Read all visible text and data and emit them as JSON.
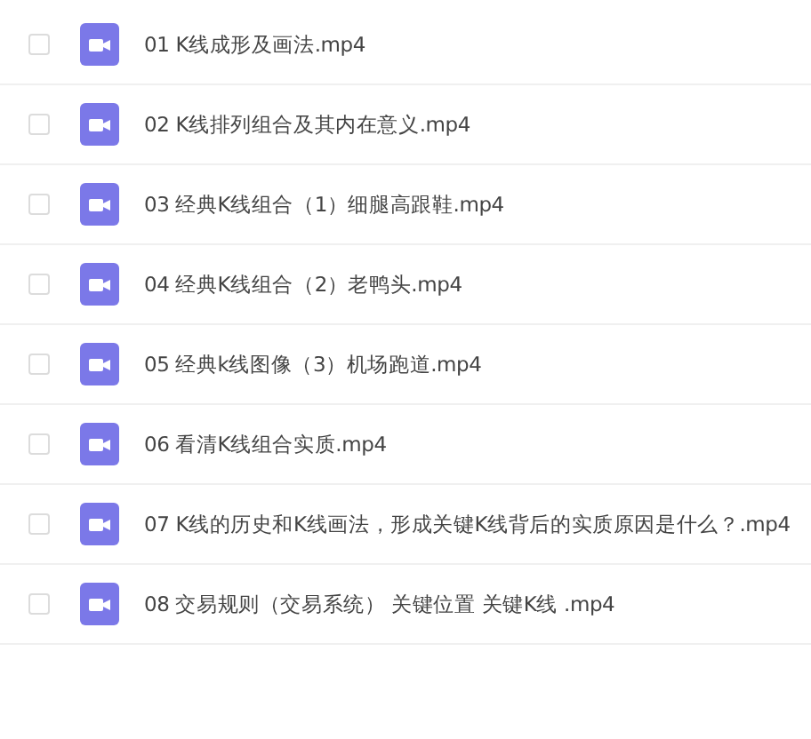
{
  "files": [
    {
      "name": "01 K线成形及画法.mp4",
      "checked": false
    },
    {
      "name": "02 K线排列组合及其内在意义.mp4",
      "checked": false
    },
    {
      "name": "03 经典K线组合（1）细腿高跟鞋.mp4",
      "checked": false
    },
    {
      "name": "04 经典K线组合（2）老鸭头.mp4",
      "checked": false
    },
    {
      "name": "05 经典k线图像（3）机场跑道.mp4",
      "checked": false
    },
    {
      "name": "06 看清K线组合实质.mp4",
      "checked": false
    },
    {
      "name": "07 K线的历史和K线画法，形成关键K线背后的实质原因是什么？.mp4",
      "checked": false
    },
    {
      "name": "08 交易规则（交易系统） 关键位置 关键K线 .mp4",
      "checked": false
    }
  ]
}
